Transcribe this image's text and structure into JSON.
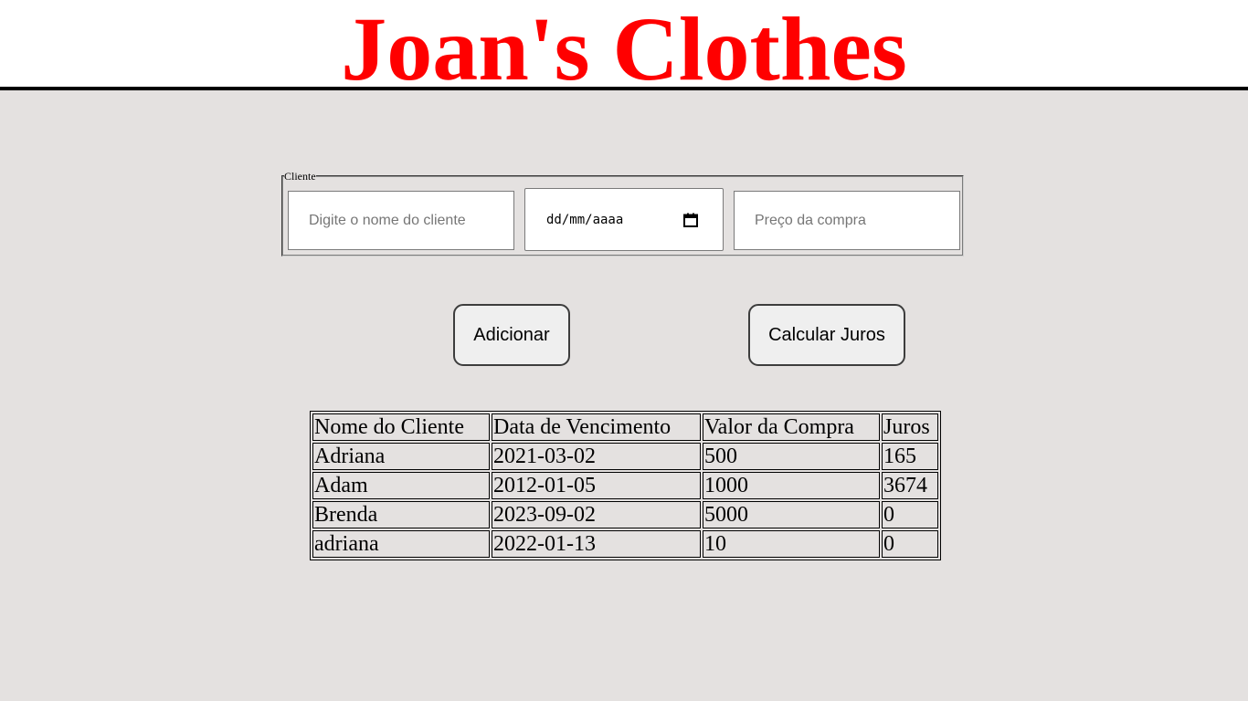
{
  "header": {
    "title": "Joan's Clothes",
    "title_color": "#ff0000"
  },
  "form": {
    "legend": "Cliente",
    "name_placeholder": "Digite o nome do cliente",
    "date_placeholder": "dd/mm/aaaa",
    "date_icon": "calendar-icon",
    "price_placeholder": "Preço da compra"
  },
  "buttons": {
    "add_label": "Adicionar",
    "calc_label": "Calcular Juros"
  },
  "table": {
    "headers": [
      "Nome do Cliente",
      "Data de Vencimento",
      "Valor da Compra",
      "Juros"
    ],
    "rows": [
      [
        "Adriana",
        "2021-03-02",
        "500",
        "165"
      ],
      [
        "Adam",
        "2012-01-05",
        "1000",
        "3674"
      ],
      [
        "Brenda",
        "2023-09-02",
        "5000",
        "0"
      ],
      [
        "adriana",
        "2022-01-13",
        "10",
        "0"
      ]
    ]
  }
}
